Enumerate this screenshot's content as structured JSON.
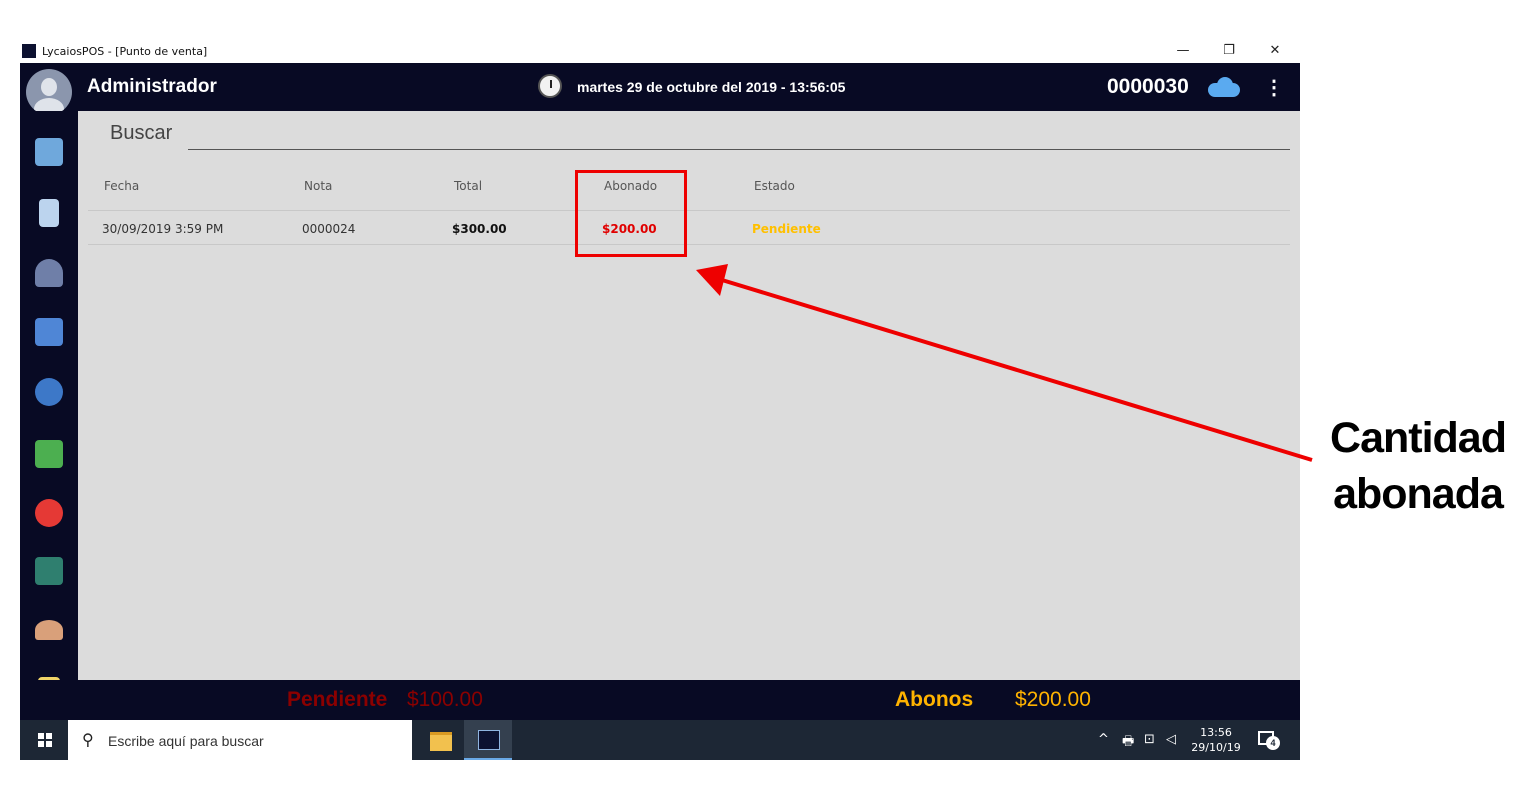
{
  "window": {
    "title": "LycaiosPOS - [Punto de venta]",
    "controls": {
      "minimize": "—",
      "restore": "❐",
      "close": "✕"
    }
  },
  "header": {
    "user": "Administrador",
    "datetime": "martes 29 de octubre del 2019 - 13:56:05",
    "ticket_number": "0000030",
    "sync_icon": "cloud-sync-icon",
    "menu_icon": "⋮"
  },
  "sidebar": {
    "items": [
      {
        "icon": "sales-register-icon",
        "color": "#6fa8dc"
      },
      {
        "icon": "notebook-icon",
        "color": "#bcd4ee"
      },
      {
        "icon": "customers-icon",
        "color": "#6f7fa8"
      },
      {
        "icon": "orders-clock-icon",
        "color": "#4f86d6"
      },
      {
        "icon": "top-badge-icon",
        "color": "#3d78c8"
      },
      {
        "icon": "money-icon",
        "color": "#4caf50"
      },
      {
        "icon": "timer-icon",
        "color": "#e53935"
      },
      {
        "icon": "warehouse-icon",
        "color": "#2f7f6f"
      },
      {
        "icon": "users-group-icon",
        "color": "#d9a07a"
      },
      {
        "icon": "reports-icon",
        "color": "#f0d468"
      }
    ]
  },
  "search": {
    "label": "Buscar"
  },
  "table": {
    "columns": [
      "Fecha",
      "Nota",
      "Total",
      "Abonado",
      "Estado"
    ],
    "rows": [
      {
        "fecha": "30/09/2019 3:59 PM",
        "nota": "0000024",
        "total": "$300.00",
        "abonado": "$200.00",
        "estado": "Pendiente"
      }
    ]
  },
  "footer": {
    "pendiente_label": "Pendiente",
    "pendiente_value": "$100.00",
    "abonos_label": "Abonos",
    "abonos_value": "$200.00"
  },
  "taskbar": {
    "search_placeholder": "Escribe aquí para buscar",
    "tray_chevron": "^",
    "time": "13:56",
    "date": "29/10/19",
    "notifications": "4"
  },
  "annotation": {
    "line1": "Cantidad",
    "line2": "abonada"
  },
  "colors": {
    "dark_bar": "#080a24",
    "content_bg": "#dcdcdc",
    "pending_red": "#8b0000",
    "abono_yellow": "#ffb300",
    "highlight_red": "#ee0000"
  }
}
